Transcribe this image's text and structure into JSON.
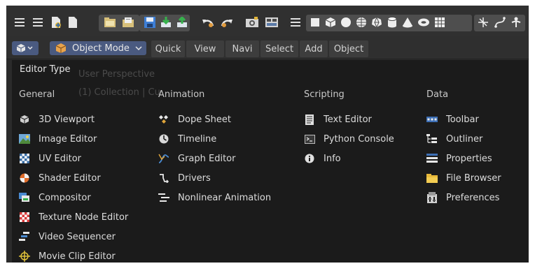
{
  "header": {
    "mode_label": "Object Mode",
    "menus": [
      {
        "label": "Quick"
      },
      {
        "label": "View"
      },
      {
        "label": "Navi"
      },
      {
        "label": "Select"
      },
      {
        "label": "Add"
      },
      {
        "label": "Object"
      }
    ]
  },
  "viewport_ghost": {
    "perspective_label": "User Perspective",
    "collection_label": "(1) Collection | Cu"
  },
  "popup": {
    "title": "Editor Type",
    "columns": [
      {
        "heading": "General",
        "items": [
          {
            "label": "3D Viewport",
            "icon": "cube-icon"
          },
          {
            "label": "Image Editor",
            "icon": "image-icon"
          },
          {
            "label": "UV Editor",
            "icon": "uv-checker-icon"
          },
          {
            "label": "Shader Editor",
            "icon": "shader-ball-icon"
          },
          {
            "label": "Compositor",
            "icon": "compositor-icon"
          },
          {
            "label": "Texture Node Editor",
            "icon": "texture-checker-icon"
          },
          {
            "label": "Video Sequencer",
            "icon": "sequencer-icon"
          },
          {
            "label": "Movie Clip Editor",
            "icon": "movie-clip-icon"
          }
        ]
      },
      {
        "heading": "Animation",
        "items": [
          {
            "label": "Dope Sheet",
            "icon": "dope-sheet-icon"
          },
          {
            "label": "Timeline",
            "icon": "timeline-icon"
          },
          {
            "label": "Graph Editor",
            "icon": "graph-icon"
          },
          {
            "label": "Drivers",
            "icon": "drivers-icon"
          },
          {
            "label": "Nonlinear Animation",
            "icon": "nla-icon"
          }
        ]
      },
      {
        "heading": "Scripting",
        "items": [
          {
            "label": "Text Editor",
            "icon": "text-document-icon"
          },
          {
            "label": "Python Console",
            "icon": "console-icon"
          },
          {
            "label": "Info",
            "icon": "info-icon"
          }
        ]
      },
      {
        "heading": "Data",
        "items": [
          {
            "label": "Toolbar",
            "icon": "toolbar-icon"
          },
          {
            "label": "Outliner",
            "icon": "outliner-icon"
          },
          {
            "label": "Properties",
            "icon": "properties-icon"
          },
          {
            "label": "File Browser",
            "icon": "folder-icon"
          },
          {
            "label": "Preferences",
            "icon": "preferences-icon"
          }
        ]
      }
    ]
  }
}
